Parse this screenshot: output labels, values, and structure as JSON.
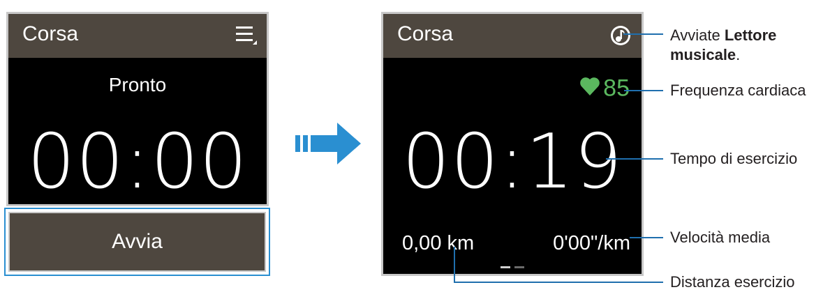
{
  "left_screen": {
    "title": "Corsa",
    "menu_icon": "menu-icon",
    "status": "Pronto",
    "timer": "00:00",
    "start_button": "Avvia"
  },
  "right_screen": {
    "title": "Corsa",
    "music_icon": "music-note-icon",
    "heart_icon": "heart-icon",
    "heart_rate": "85",
    "timer": "00:19",
    "distance": "0,00 km",
    "pace": "0'00\"/km"
  },
  "callouts": {
    "music_prefix": "Avviate ",
    "music_bold": "Lettore musicale",
    "music_suffix": ".",
    "heart_rate": "Frequenza cardiaca",
    "exercise_time": "Tempo di esercizio",
    "avg_speed": "Velocità media",
    "distance": "Distanza esercizio"
  },
  "colors": {
    "header": "#4e473f",
    "heart_green": "#5bb85f",
    "accent_blue": "#2a8fd1",
    "callout_blue": "#1f6fae"
  }
}
